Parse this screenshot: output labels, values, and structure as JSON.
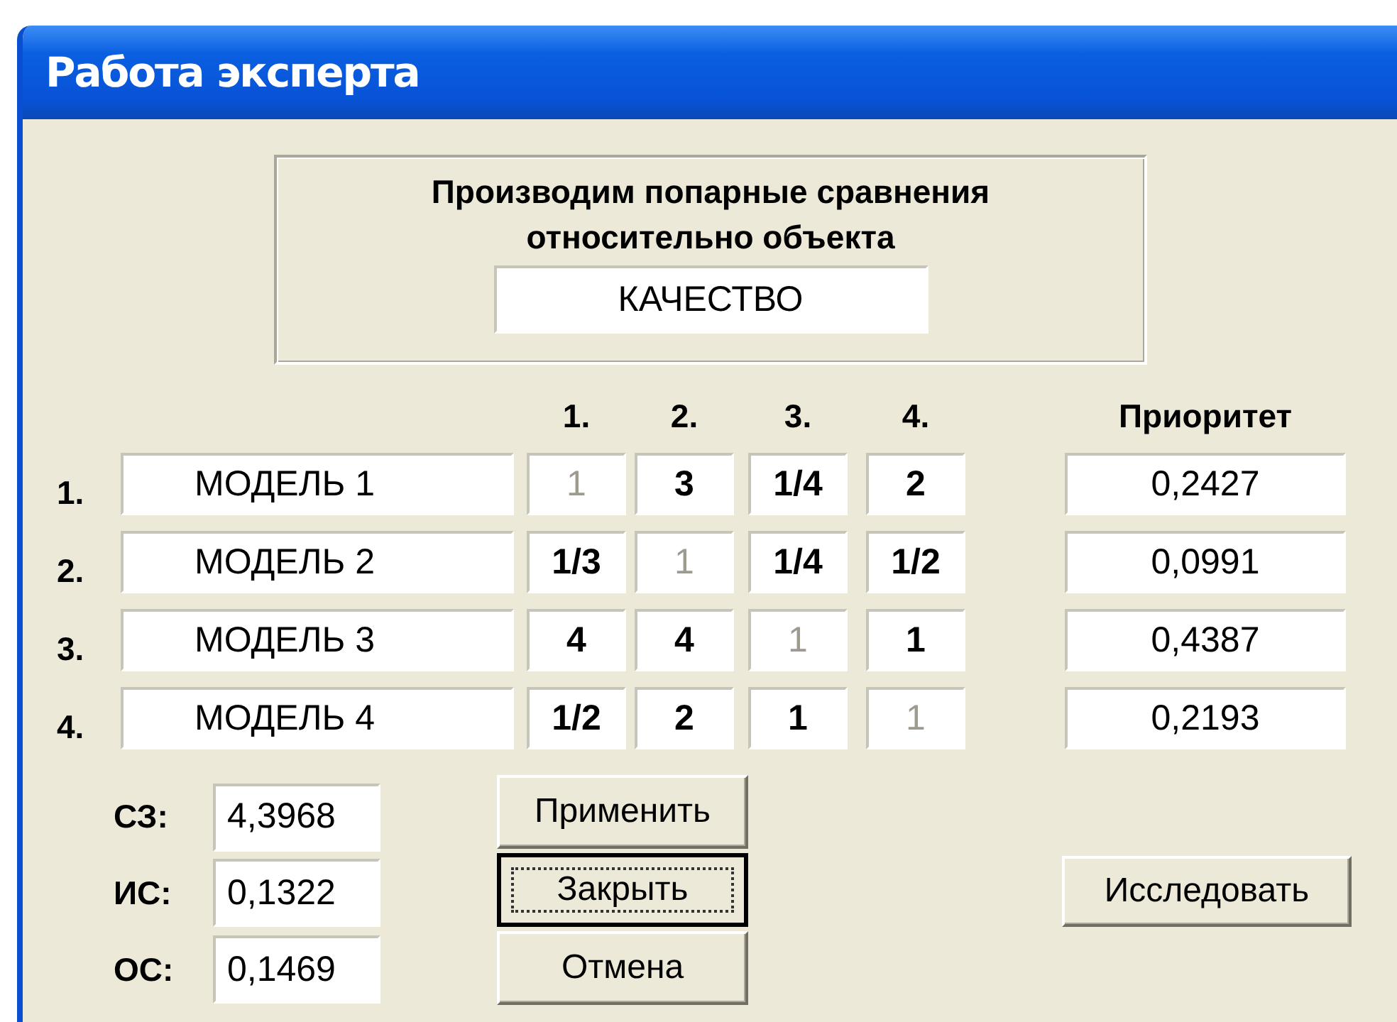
{
  "window": {
    "title": "Работа эксперта"
  },
  "group": {
    "caption": "Производим попарные сравнения относительно объекта",
    "object": "КАЧЕСТВО"
  },
  "matrix": {
    "columns": [
      "1.",
      "2.",
      "3.",
      "4."
    ],
    "priority_heading": "Приоритет",
    "rows": [
      {
        "index": "1.",
        "name": "МОДЕЛЬ 1",
        "cells": [
          {
            "text": "1",
            "disabled": true
          },
          {
            "text": "3",
            "disabled": false
          },
          {
            "text": "1/4",
            "disabled": false
          },
          {
            "text": "2",
            "disabled": false
          }
        ],
        "priority": "0,2427"
      },
      {
        "index": "2.",
        "name": "МОДЕЛЬ 2",
        "cells": [
          {
            "text": "1/3",
            "disabled": false
          },
          {
            "text": "1",
            "disabled": true
          },
          {
            "text": "1/4",
            "disabled": false
          },
          {
            "text": "1/2",
            "disabled": false
          }
        ],
        "priority": "0,0991"
      },
      {
        "index": "3.",
        "name": "МОДЕЛЬ 3",
        "cells": [
          {
            "text": "4",
            "disabled": false
          },
          {
            "text": "4",
            "disabled": false
          },
          {
            "text": "1",
            "disabled": true
          },
          {
            "text": "1",
            "disabled": false
          }
        ],
        "priority": "0,4387"
      },
      {
        "index": "4.",
        "name": "МОДЕЛЬ 4",
        "cells": [
          {
            "text": "1/2",
            "disabled": false
          },
          {
            "text": "2",
            "disabled": false
          },
          {
            "text": "1",
            "disabled": false
          },
          {
            "text": "1",
            "disabled": true
          }
        ],
        "priority": "0,2193"
      }
    ]
  },
  "indices": [
    {
      "label": "СЗ:",
      "value": "4,3968"
    },
    {
      "label": "ИС:",
      "value": "0,1322"
    },
    {
      "label": "ОС:",
      "value": "0,1469"
    }
  ],
  "buttons": [
    {
      "label": "Применить",
      "default": false
    },
    {
      "label": "Закрыть",
      "default": true
    },
    {
      "label": "Отмена",
      "default": false
    }
  ],
  "research_button": {
    "label": "Исследовать"
  }
}
